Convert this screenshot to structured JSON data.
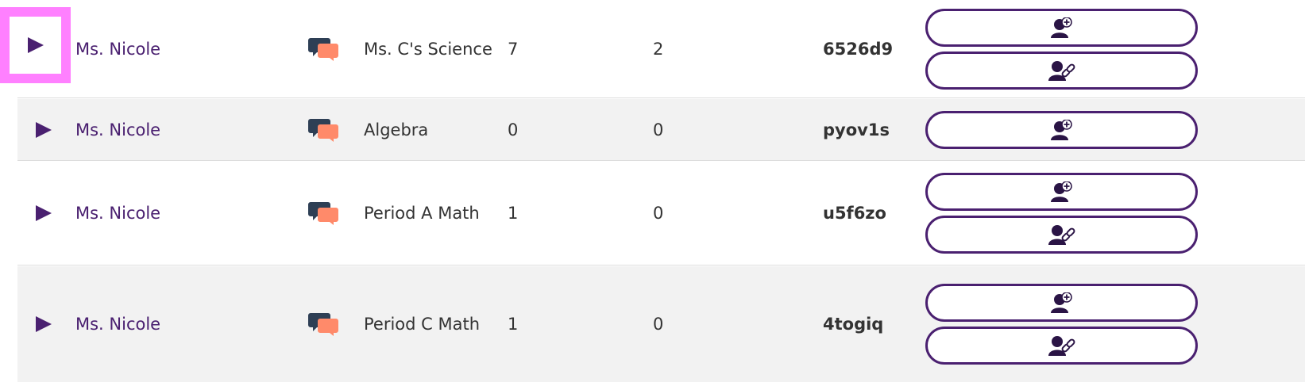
{
  "rows": [
    {
      "teacher": "Ms. Nicole",
      "class_name": "Ms. C's Science",
      "students": "7",
      "active": "2",
      "code": "6526d9",
      "actions": [
        "add-student-icon",
        "link-student-icon"
      ]
    },
    {
      "teacher": "Ms. Nicole",
      "class_name": "Algebra",
      "students": "0",
      "active": "0",
      "code": "pyov1s",
      "actions": [
        "add-student-icon"
      ]
    },
    {
      "teacher": "Ms. Nicole",
      "class_name": "Period A Math",
      "students": "1",
      "active": "0",
      "code": "u5f6zo",
      "actions": [
        "add-student-icon",
        "link-student-icon"
      ]
    },
    {
      "teacher": "Ms. Nicole",
      "class_name": "Period C Math",
      "students": "1",
      "active": "0",
      "code": "4togiq",
      "actions": [
        "add-student-icon",
        "link-student-icon"
      ]
    }
  ],
  "colors": {
    "brand_purple": "#4a2070",
    "row_shade": "#f2f2f2",
    "chat_dark": "#2e3f55",
    "chat_accent": "#ff8a6a",
    "highlight": "#ff80ff"
  }
}
